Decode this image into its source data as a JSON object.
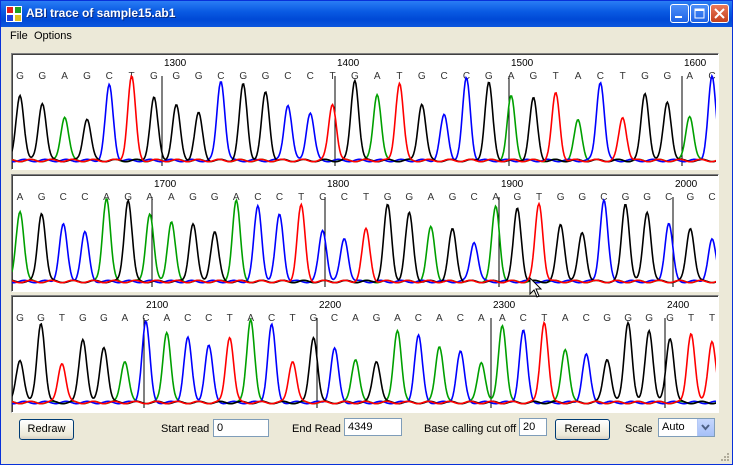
{
  "window": {
    "title": "ABI trace of sample15.ab1"
  },
  "menu": {
    "items": [
      "File",
      "Options"
    ]
  },
  "panels": [
    {
      "ticks": [
        {
          "pos": 1300,
          "label": "1300"
        },
        {
          "pos": 1400,
          "label": "1400"
        },
        {
          "pos": 1500,
          "label": "1500"
        },
        {
          "pos": 1600,
          "label": "1600"
        }
      ],
      "sequence": [
        "G",
        "G",
        "A",
        "G",
        "C",
        "T",
        "G",
        "G",
        "G",
        "C",
        "G",
        "G",
        "C",
        "C",
        "T",
        "G",
        "A",
        "T",
        "G",
        "C",
        "C",
        "G",
        "A",
        "G",
        "T",
        "A",
        "C",
        "T",
        "G",
        "G",
        "A",
        "C"
      ]
    },
    {
      "ticks": [
        {
          "pos": 1700,
          "label": "1700"
        },
        {
          "pos": 1800,
          "label": "1800"
        },
        {
          "pos": 1900,
          "label": "1900"
        },
        {
          "pos": 2000,
          "label": "2000"
        }
      ],
      "sequence": [
        "A",
        "G",
        "C",
        "C",
        "A",
        "G",
        "A",
        "A",
        "G",
        "G",
        "A",
        "C",
        "C",
        "T",
        "C",
        "C",
        "T",
        "G",
        "G",
        "A",
        "G",
        "C",
        "A",
        "G",
        "T",
        "G",
        "G",
        "C",
        "G",
        "G",
        "C",
        "G",
        "C"
      ]
    },
    {
      "ticks": [
        {
          "pos": 2100,
          "label": "2100"
        },
        {
          "pos": 2200,
          "label": "2200"
        },
        {
          "pos": 2300,
          "label": "2300"
        },
        {
          "pos": 2400,
          "label": "2400"
        }
      ],
      "sequence": [
        "G",
        "G",
        "T",
        "G",
        "G",
        "A",
        "C",
        "A",
        "C",
        "C",
        "T",
        "A",
        "C",
        "T",
        "G",
        "C",
        "A",
        "G",
        "A",
        "C",
        "A",
        "C",
        "A",
        "A",
        "C",
        "T",
        "A",
        "C",
        "G",
        "G",
        "G",
        "G",
        "T",
        "T"
      ]
    }
  ],
  "base_colors": {
    "A": "#00a000",
    "C": "#0000ff",
    "G": "#000000",
    "T": "#ff0000"
  },
  "controls": {
    "redraw_label": "Redraw",
    "start_read_label": "Start read",
    "start_read_value": "0",
    "end_read_label": "End Read",
    "end_read_value": "4349",
    "cutoff_label": "Base calling cut off",
    "cutoff_value": "20",
    "reread_label": "Reread",
    "scale_label": "Scale",
    "scale_value": "Auto"
  }
}
